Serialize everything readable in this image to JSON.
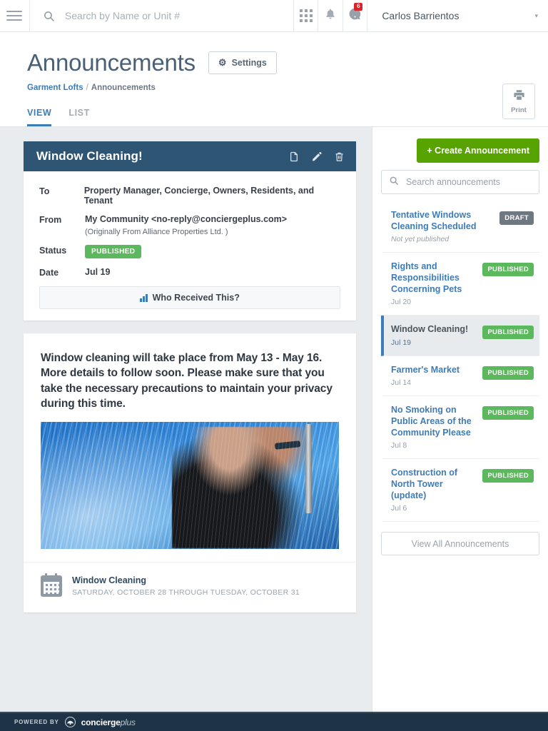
{
  "topbar": {
    "menu_icon": "hamburger-icon",
    "search_placeholder": "Search by Name or Unit #",
    "search_value": "",
    "apps_icon": "grid-apps-icon",
    "bell_icon": "bell-icon",
    "messages_icon": "messages-icon",
    "messages_badge": "6",
    "user_name": "Carlos Barrientos",
    "caret": "▾"
  },
  "page": {
    "title": "Announcements",
    "settings_label": "Settings",
    "print_label": "Print",
    "breadcrumb": {
      "root": "Garment Lofts",
      "separator": "/",
      "current": "Announcements"
    },
    "tabs": [
      {
        "label": "VIEW",
        "active": true
      },
      {
        "label": "LIST",
        "active": false
      }
    ]
  },
  "announcement": {
    "title": "Window Cleaning!",
    "actions": [
      {
        "name": "duplicate-icon"
      },
      {
        "name": "edit-icon"
      },
      {
        "name": "delete-icon"
      }
    ],
    "fields": {
      "to_label": "To",
      "to_value": "Property Manager, Concierge, Owners, Residents, and Tenant",
      "from_label": "From",
      "from_value": "My Community <no-reply@conciergeplus.com>",
      "from_sub": "(Originally From Alliance Properties Ltd. )",
      "status_label": "Status",
      "status_value": "PUBLISHED",
      "date_label": "Date",
      "date_value": "Jul 19"
    },
    "who_received_label": "Who Received This?",
    "body_text": "Window cleaning will take place from May 13 - May 16. More details to follow soon. Please make sure that you take the necessary precautions to maintain your privacy during this time.",
    "image_alt": "window-cleaner-photo",
    "event": {
      "title": "Window Cleaning",
      "dates": "SATURDAY, OCTOBER 28 THROUGH TUESDAY, OCTOBER 31"
    }
  },
  "sidebar": {
    "create_label": "+ Create Announcement",
    "search_placeholder": "Search announcements",
    "search_value": "",
    "view_all_label": "View All Announcements",
    "items": [
      {
        "title": "Tentative Windows Cleaning Scheduled",
        "sub": "Not yet published",
        "sub_italic": true,
        "tag": "DRAFT",
        "tag_type": "draft",
        "active": false
      },
      {
        "title": "Rights and Responsibilities Concerning Pets",
        "sub": "Jul 20",
        "sub_italic": false,
        "tag": "PUBLISHED",
        "tag_type": "published",
        "active": false
      },
      {
        "title": "Window Cleaning!",
        "sub": "Jul 19",
        "sub_italic": false,
        "tag": "PUBLISHED",
        "tag_type": "published",
        "active": true
      },
      {
        "title": "Farmer's Market",
        "sub": "Jul 14",
        "sub_italic": false,
        "tag": "PUBLISHED",
        "tag_type": "published",
        "active": false
      },
      {
        "title": "No Smoking on Public Areas of the Community Please",
        "sub": "Jul 8",
        "sub_italic": false,
        "tag": "PUBLISHED",
        "tag_type": "published",
        "active": false
      },
      {
        "title": "Construction of North Tower (update)",
        "sub": "Jul 6",
        "sub_italic": false,
        "tag": "PUBLISHED",
        "tag_type": "published",
        "active": false
      }
    ]
  },
  "footer": {
    "powered_by": "POWERED BY",
    "brand": "concierge",
    "brand_italic": "plus"
  },
  "colors": {
    "accent_blue": "#3e7cb8",
    "card_header": "#2e5573",
    "published_green": "#5cb85c",
    "draft_gray": "#6f7880",
    "create_green": "#57a400",
    "footer_navy": "#1f3347",
    "pane_bg": "#e8ecee"
  }
}
